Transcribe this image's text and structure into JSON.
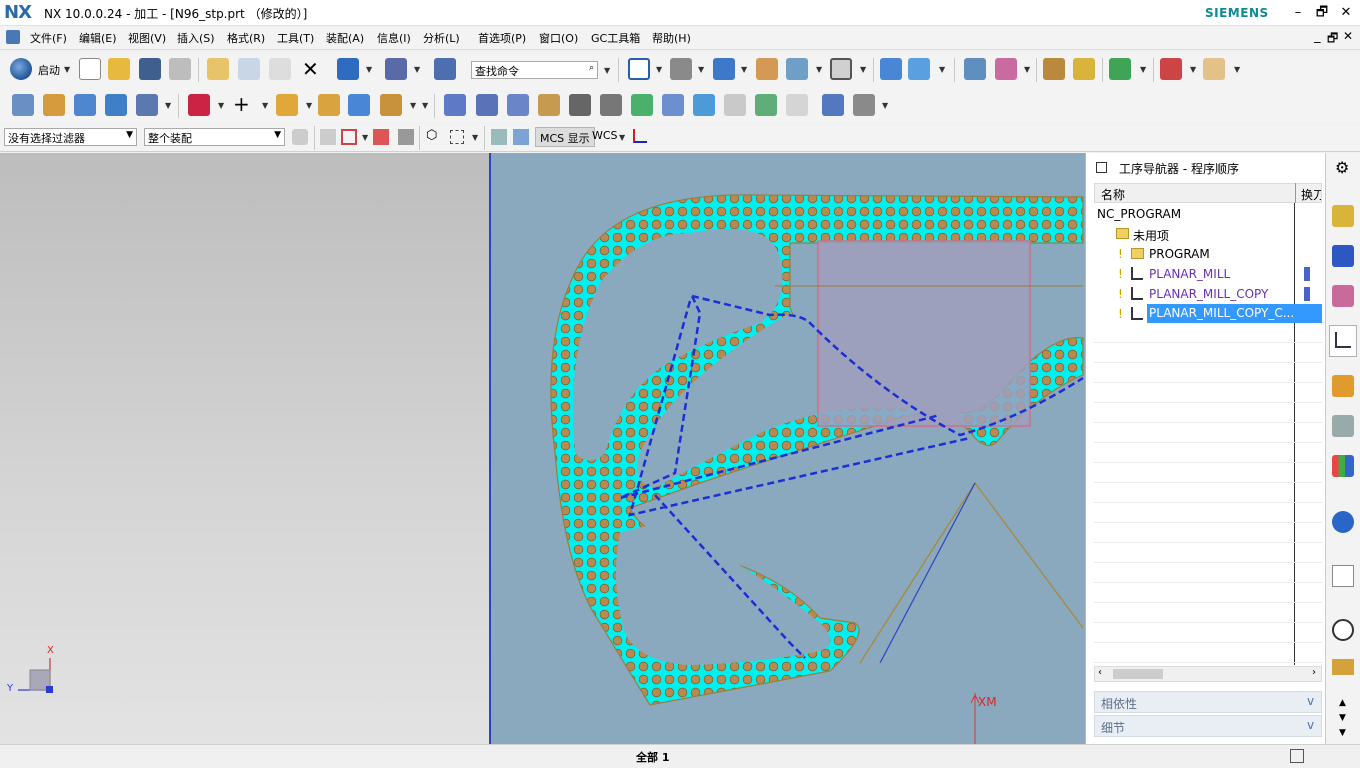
{
  "window": {
    "logo": "NX",
    "title": "NX 10.0.0.24 - 加工 - [N96_stp.prt （修改的）]",
    "brand": "SIEMENS",
    "minimize": "–",
    "restore": "🗗",
    "close": "✕"
  },
  "menu": [
    "文件(F)",
    "编辑(E)",
    "视图(V)",
    "插入(S)",
    "格式(R)",
    "工具(T)",
    "装配(A)",
    "信息(I)",
    "分析(L)",
    "首选项(P)",
    "窗口(O)",
    "GC工具箱",
    "帮助(H)"
  ],
  "toolbar": {
    "start_label": "启动",
    "search_placeholder": "查找命令"
  },
  "selection_bar": {
    "filter_value": "没有选择过滤器",
    "scope_value": "整个装配",
    "mcs_label": "MCS 显示",
    "wcs_label": "WCS"
  },
  "viewport": {
    "triad_x": "X",
    "triad_y": "Y",
    "xm_label": "XM"
  },
  "navigator": {
    "title": "工序导航器 - 程序顺序",
    "col_name": "名称",
    "col_tool": "换刀",
    "rows": [
      {
        "label": "NC_PROGRAM"
      },
      {
        "label": "未用项"
      },
      {
        "label": "PROGRAM"
      },
      {
        "label": "PLANAR_MILL"
      },
      {
        "label": "PLANAR_MILL_COPY"
      },
      {
        "label": "PLANAR_MILL_COPY_C..."
      }
    ],
    "panel_dependencies": "相依性",
    "panel_details": "细节"
  },
  "status": {
    "center": "全部 1"
  },
  "colors": {
    "viewport_bg": "#8ba9be",
    "toolpath": "#1c2fd6",
    "part": "#00f2f2",
    "selected_row": "#3399ff"
  }
}
